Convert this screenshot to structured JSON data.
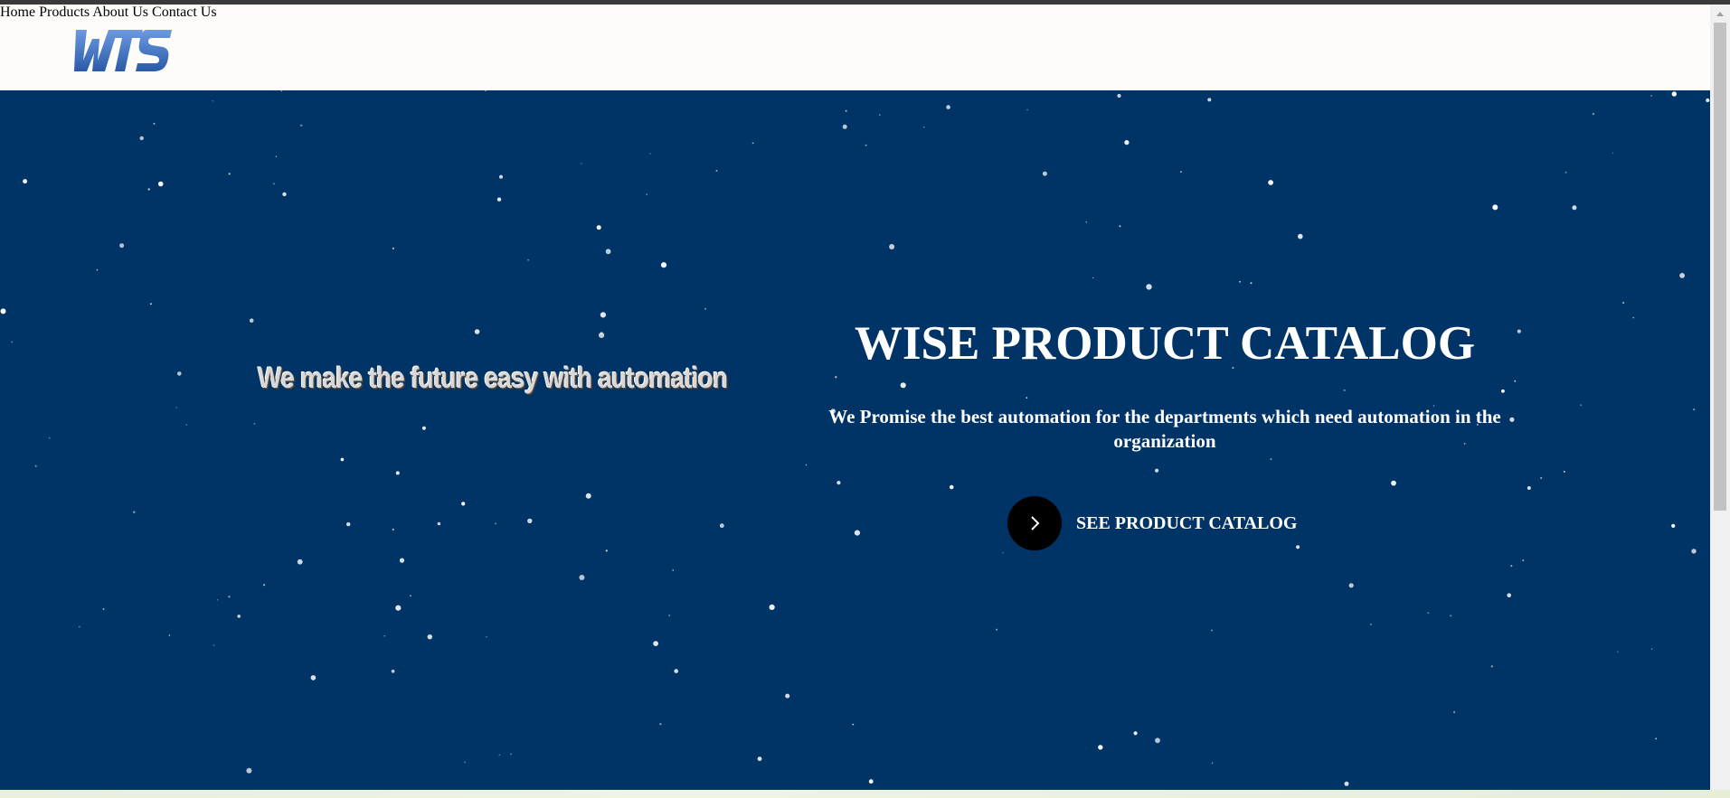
{
  "header": {
    "logo_text": "WTS",
    "nav": [
      {
        "label": "Home"
      },
      {
        "label": "Products"
      },
      {
        "label": "About Us"
      },
      {
        "label": "Contact Us"
      }
    ]
  },
  "hero": {
    "tagline": "We make the future easy with automation",
    "title": "WISE PRODUCT CATALOG",
    "subtitle": "We Promise the best automation for the departments which need automation in the organization",
    "cta_label": "SEE PRODUCT CATALOG",
    "cta_icon": "chevron-right-icon"
  },
  "colors": {
    "hero_background": "#003366",
    "header_background": "#fdfcf8",
    "logo_blue": "#3a6fc0",
    "cta_circle": "#000000",
    "text_on_hero": "#ffffff"
  }
}
